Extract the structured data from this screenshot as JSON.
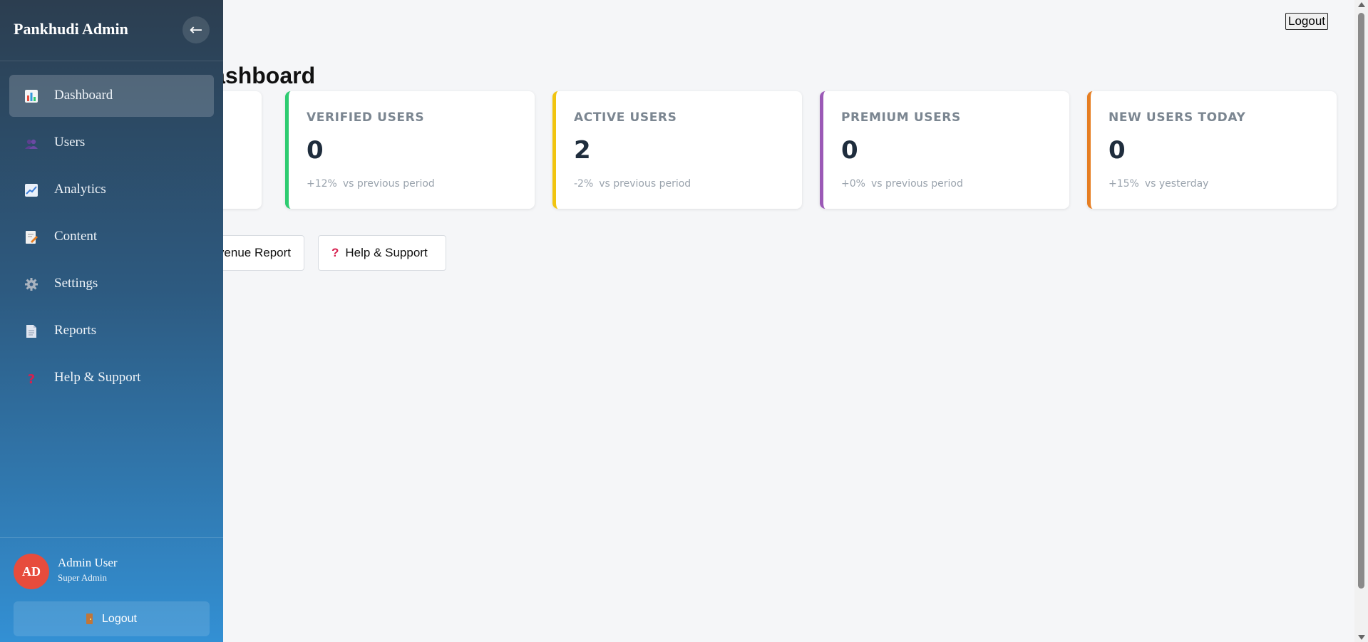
{
  "header": {
    "logout_label": "Logout"
  },
  "page": {
    "title": "Dashboard"
  },
  "cards": [
    {
      "label": "",
      "value": "",
      "delta_pct": "",
      "delta_text": "",
      "accent": "#3498db"
    },
    {
      "label": "Verified Users",
      "value": "0",
      "delta_pct": "+12%",
      "delta_text": "vs previous period",
      "accent": "#2ecc71"
    },
    {
      "label": "Active Users",
      "value": "2",
      "delta_pct": "-2%",
      "delta_text": "vs previous period",
      "accent": "#f1c40f"
    },
    {
      "label": "Premium Users",
      "value": "0",
      "delta_pct": "+0%",
      "delta_text": "vs previous period",
      "accent": "#9b59b6"
    },
    {
      "label": "New Users Today",
      "value": "0",
      "delta_pct": "+15%",
      "delta_text": "vs yesterday",
      "accent": "#e67e22"
    }
  ],
  "actions": [
    {
      "label": "venue Report",
      "icon": "report-icon"
    },
    {
      "label": "Help & Support",
      "icon": "question-icon"
    }
  ],
  "sidebar": {
    "brand": "Pankhudi Admin",
    "collapse_glyph": "←",
    "items": [
      {
        "label": "Dashboard",
        "icon": "bar-chart-icon",
        "active": true
      },
      {
        "label": "Users",
        "icon": "users-icon"
      },
      {
        "label": "Analytics",
        "icon": "line-chart-icon"
      },
      {
        "label": "Content",
        "icon": "edit-document-icon"
      },
      {
        "label": "Settings",
        "icon": "gear-icon"
      },
      {
        "label": "Reports",
        "icon": "document-icon"
      },
      {
        "label": "Help & Support",
        "icon": "question-icon"
      }
    ],
    "user": {
      "initials": "AD",
      "name": "Admin User",
      "role": "Super Admin",
      "avatar_color": "#e74c3c"
    },
    "logout_label": "Logout"
  }
}
